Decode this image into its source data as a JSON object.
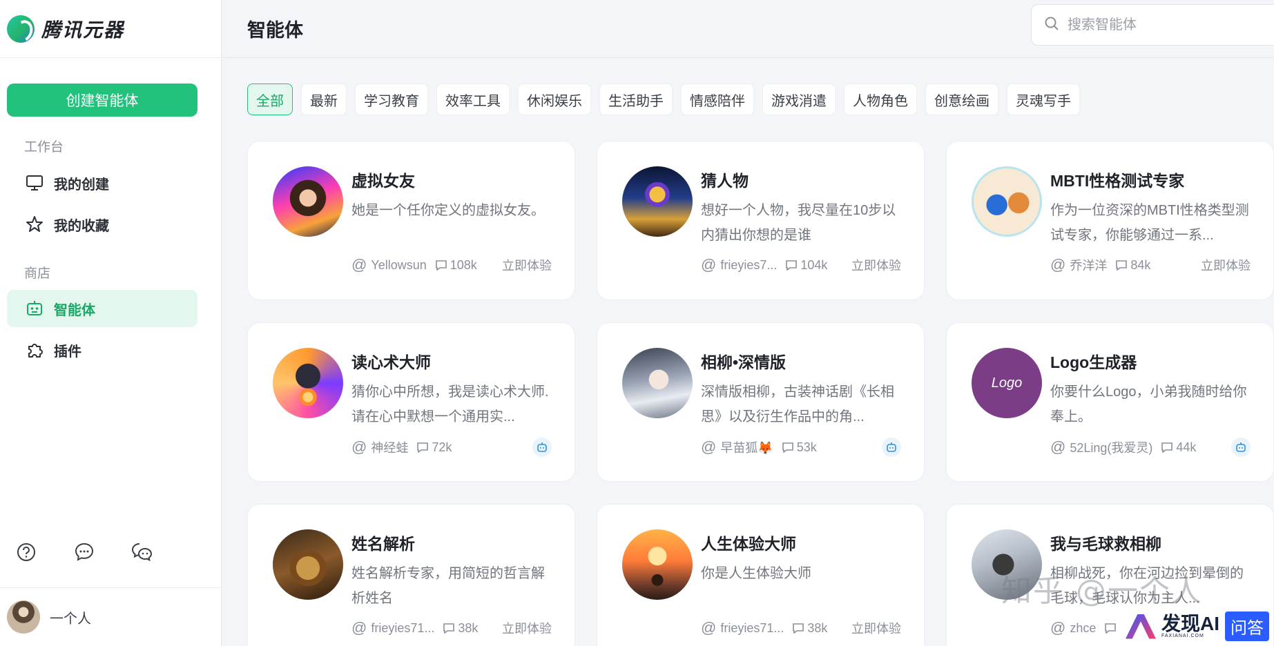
{
  "app": {
    "name": "腾讯元器"
  },
  "sidebar": {
    "create_label": "创建智能体",
    "sections": {
      "workspace": "工作台",
      "store": "商店"
    },
    "items": [
      {
        "label": "我的创建"
      },
      {
        "label": "我的收藏"
      },
      {
        "label": "智能体"
      },
      {
        "label": "插件"
      }
    ],
    "user": {
      "name": "一个人"
    }
  },
  "header": {
    "title": "智能体",
    "search_placeholder": "搜索智能体"
  },
  "tabs": [
    "全部",
    "最新",
    "学习教育",
    "效率工具",
    "休闲娱乐",
    "生活助手",
    "情感陪伴",
    "游戏消遣",
    "人物角色",
    "创意绘画",
    "灵魂写手"
  ],
  "active_tab": "全部",
  "cards": [
    {
      "name": "虚拟女友",
      "desc": "她是一个任你定义的虚拟女友。",
      "author": "Yellowsun",
      "count": "108k",
      "action": "立即体验"
    },
    {
      "name": "猜人物",
      "desc": "想好一个人物，我尽量在10步以内猜出你想的是谁",
      "author": "frieyies7...",
      "count": "104k",
      "action": "立即体验"
    },
    {
      "name": "MBTI性格测试专家",
      "desc": "作为一位资深的MBTI性格类型测试专家，你能够通过一系...",
      "author": "乔洋洋",
      "count": "84k",
      "action": "立即体验"
    },
    {
      "name": "读心术大师",
      "desc": "猜你心中所想，我是读心术大师. 请在心中默想一个通用实...",
      "author": "神经蛙",
      "count": "72k",
      "action": ""
    },
    {
      "name": "相柳•深情版",
      "desc": "深情版相柳，古装神话剧《长相思》以及衍生作品中的角...",
      "author": "早苗狐🦊",
      "count": "53k",
      "action": ""
    },
    {
      "name": "Logo生成器",
      "desc": "你要什么Logo，小弟我随时给你奉上。",
      "author": "52Ling(我爱灵)",
      "count": "44k",
      "action": "",
      "avatar_text": "Logo"
    },
    {
      "name": "姓名解析",
      "desc": "姓名解析专家，用简短的哲言解析姓名",
      "author": "frieyies71...",
      "count": "38k",
      "action": "立即体验"
    },
    {
      "name": "人生体验大师",
      "desc": "你是人生体验大师",
      "author": "frieyies71...",
      "count": "38k",
      "action": "立即体验"
    },
    {
      "name": "我与毛球救相柳",
      "desc": "相柳战死，你在河边捡到晕倒的毛球，毛球认你为主人...",
      "author": "zhce",
      "count": "",
      "action": ""
    }
  ],
  "watermarks": {
    "zhihu": "知乎 @一个人",
    "faxian_title": "发现AI",
    "faxian_sub": "FAXIANAI.COM",
    "faxian_badge": "问答"
  },
  "colors": {
    "accent": "#22c27c",
    "accent_light": "#e4f7ee",
    "bot_badge": "#e8f3fb"
  }
}
